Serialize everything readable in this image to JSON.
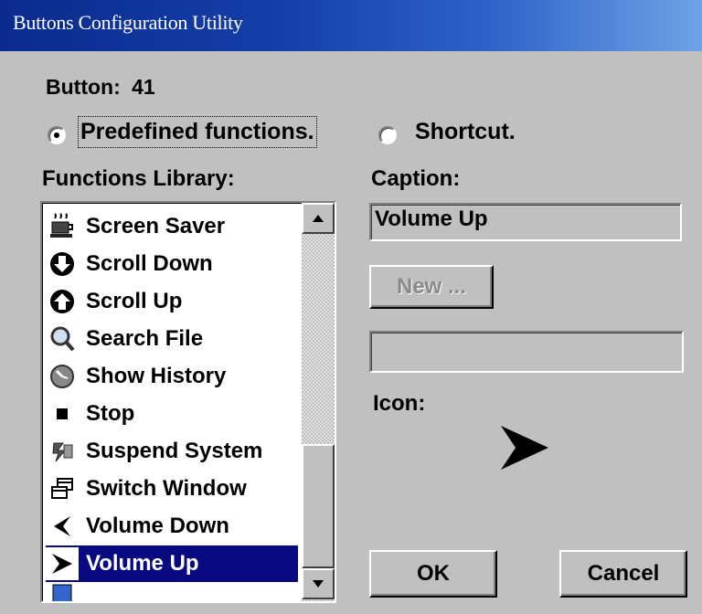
{
  "window": {
    "title": "Buttons Configuration Utility"
  },
  "button_info": {
    "label": "Button:",
    "number": "41"
  },
  "radios": {
    "predefined": {
      "label": "Predefined functions.",
      "selected": true
    },
    "shortcut": {
      "label": "Shortcut.",
      "selected": false
    }
  },
  "library": {
    "label": "Functions Library:",
    "items": [
      {
        "label": "Screen Saver",
        "icon": "coffee-cup-icon"
      },
      {
        "label": "Scroll Down",
        "icon": "arrow-down-circle-icon"
      },
      {
        "label": "Scroll Up",
        "icon": "arrow-up-circle-icon"
      },
      {
        "label": "Search File",
        "icon": "magnifier-icon"
      },
      {
        "label": "Show History",
        "icon": "history-icon"
      },
      {
        "label": "Stop",
        "icon": "stop-square-icon"
      },
      {
        "label": "Suspend System",
        "icon": "suspend-icon"
      },
      {
        "label": "Switch Window",
        "icon": "windows-icon"
      },
      {
        "label": "Volume Down",
        "icon": "chevron-left-icon"
      },
      {
        "label": "Volume Up",
        "icon": "arrow-right-icon",
        "selected": true
      }
    ]
  },
  "caption": {
    "label": "Caption:",
    "value": "Volume Up"
  },
  "new_button": {
    "label": "New ..."
  },
  "shortcut_field": {
    "value": ""
  },
  "icon_section": {
    "label": "Icon:",
    "icon": "arrow-right-icon"
  },
  "actions": {
    "ok": "OK",
    "cancel": "Cancel"
  }
}
